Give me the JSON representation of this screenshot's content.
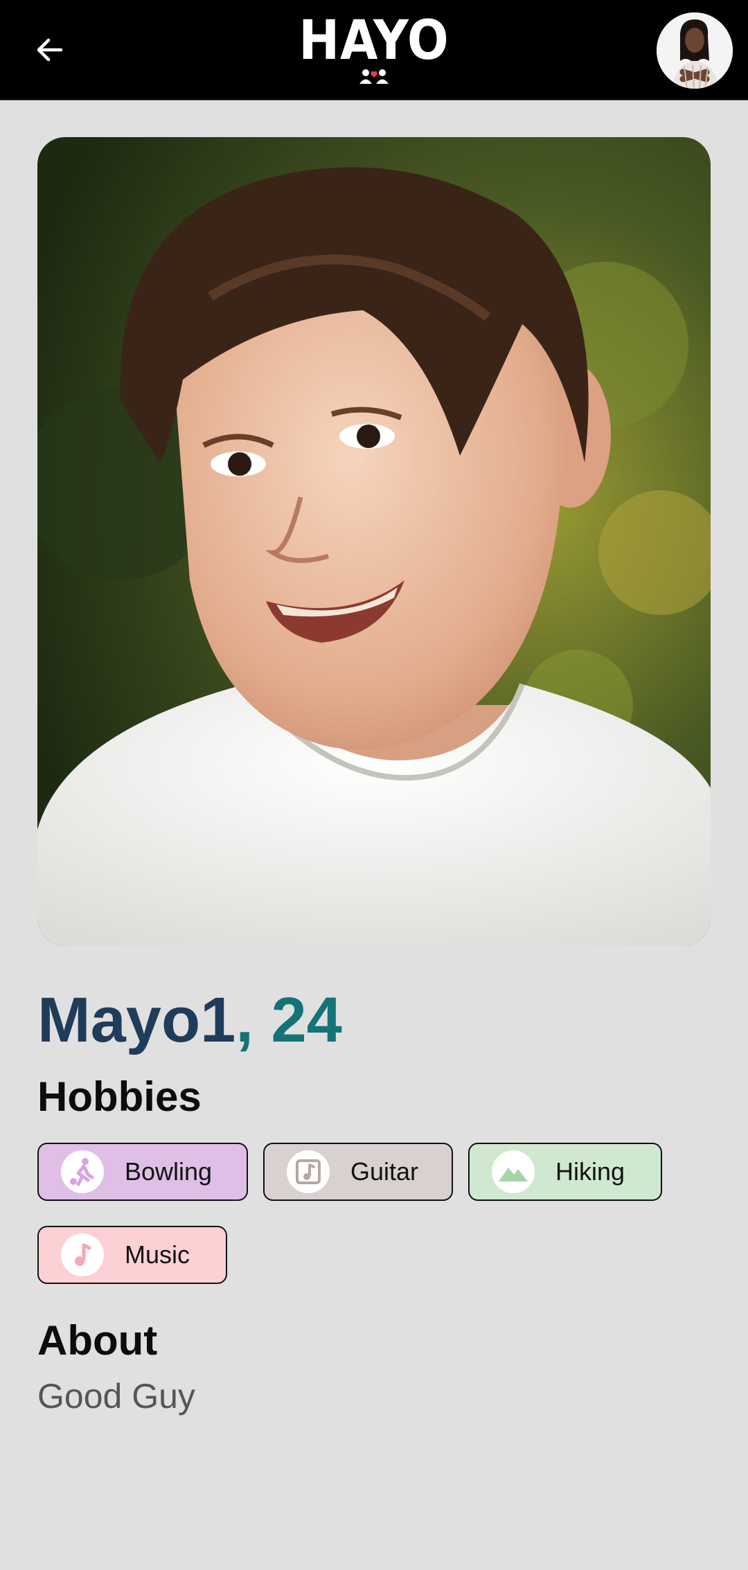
{
  "header": {
    "logo_text": "HAYO",
    "back_icon": "arrow-left-icon",
    "avatar_icon": "user-avatar"
  },
  "profile": {
    "name": "Mayo1",
    "separator": ",",
    "age": "24",
    "photo": "profile-photo-smiling-child"
  },
  "hobbies": {
    "title": "Hobbies",
    "items": [
      {
        "label": "Bowling",
        "icon": "bowling-icon",
        "bg": "#dfbfe6",
        "icon_color": "#d7a3e0"
      },
      {
        "label": "Guitar",
        "icon": "music-note-icon",
        "bg": "#d9d1cf",
        "icon_color": "#b5a7a3"
      },
      {
        "label": "Hiking",
        "icon": "mountain-icon",
        "bg": "#cfe8cf",
        "icon_color": "#a7d3a8"
      },
      {
        "label": "Music",
        "icon": "music-note-icon",
        "bg": "#fdd0d4",
        "icon_color": "#f7a8b0"
      }
    ]
  },
  "about": {
    "title": "About",
    "text": "Good Guy"
  },
  "colors": {
    "background": "#e0e0e0",
    "topbar": "#000000",
    "name": "#1f3d5b",
    "age": "#147377",
    "logo_heart": "#e53950"
  }
}
